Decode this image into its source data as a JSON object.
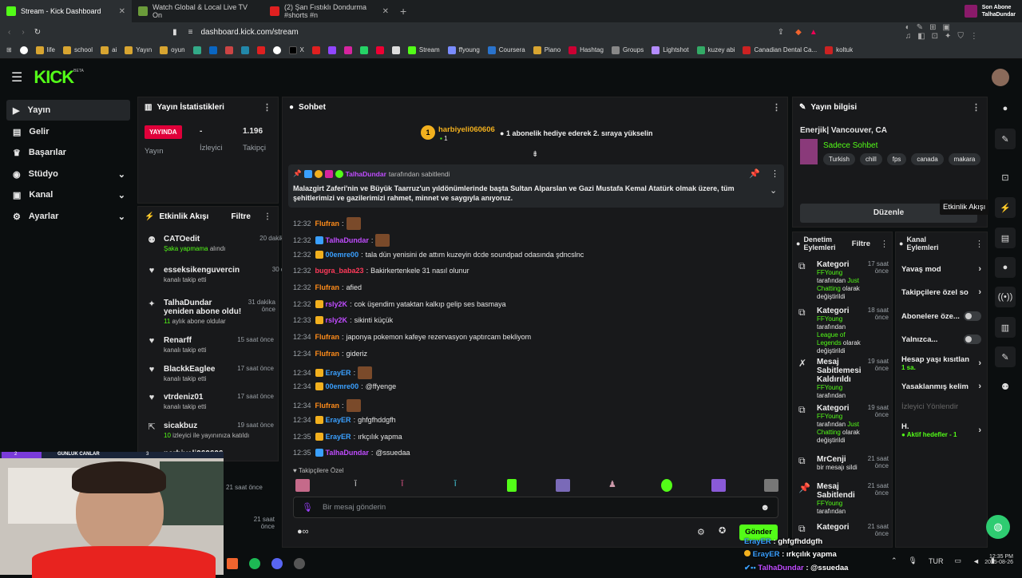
{
  "browser": {
    "tabs": [
      {
        "title": "Stream - Kick Dashboard",
        "color": "#53fc18"
      },
      {
        "title": "Watch Global & Local Live TV On",
        "color": "#6b9b3a"
      },
      {
        "title": "(2) Şan Fıstıklı Dondurma #shorts #n",
        "color": "#e02020"
      }
    ],
    "url": "dashboard.kick.com/stream",
    "bookmarks": [
      "life",
      "school",
      "ai",
      "Yayın",
      "oyun",
      "X",
      "Stream",
      "ffyoung",
      "Coursera",
      "Piano",
      "Hashtag",
      "Groups",
      "Lightshot",
      "kuzey abi",
      "Canadian Dental Ca...",
      "koltuk"
    ],
    "profile": {
      "line1": "Son Abone",
      "line2": "TalhaDundar"
    }
  },
  "kick": {
    "logo": "KICK",
    "beta": "BETA",
    "nav": [
      "Yayın",
      "Gelir",
      "Başarılar",
      "Stüdyo",
      "Kanal",
      "Ayarlar"
    ]
  },
  "stats": {
    "title": "Yayın İstatistikleri",
    "live_badge": "YAYINDA",
    "live_label": "Yayın",
    "viewers_value": "-",
    "viewers_label": "İzleyici",
    "followers_value": "1.196",
    "followers_label": "Takipçi"
  },
  "activity": {
    "title": "Etkinlik Akışı",
    "filter": "Filtre",
    "items": [
      {
        "name": "CATOedit",
        "time": "20 dakika önce",
        "hl": "Şaka yapmama",
        "rest": " alındı"
      },
      {
        "name": "esseksikenguvercin",
        "time": "30 dakika önce",
        "hl": "",
        "rest": "kanalı takip etti"
      },
      {
        "name": "TalhaDundar yeniden abone oldu!",
        "time": "31 dakika önce",
        "hl": "11",
        "rest": " aylık abone oldular"
      },
      {
        "name": "Renarff",
        "time": "15 saat önce",
        "hl": "",
        "rest": "kanalı takip etti"
      },
      {
        "name": "BlackkEaglee",
        "time": "17 saat önce",
        "hl": "",
        "rest": "kanalı takip etti"
      },
      {
        "name": "vtrdeniz01",
        "time": "17 saat önce",
        "hl": "",
        "rest": "kanalı takip etti"
      },
      {
        "name": "sicakbuz",
        "time": "19 saat önce",
        "hl": "10",
        "rest": " izleyici ile yayınınıza katıldı"
      },
      {
        "name": "narbiyeli060606",
        "time": "",
        "hl": "",
        "rest": "llanıcıya"
      }
    ],
    "extra_times": [
      "21 saat önce",
      "21 saat önce"
    ]
  },
  "chat": {
    "title": "Sohbet",
    "top_user": "harbiyeli060606",
    "top_count": "1",
    "top_rank": "1",
    "top_msg": "1 abonelik hediye ederek 2. sıraya yükselin",
    "pinned_by": "TalhaDundar",
    "pinned_suffix": " tarafından sabitlendi",
    "pinned_text": "Malazgirt Zaferi'nin ve Büyük Taarruz'un yıldönümlerinde başta Sultan Alparslan ve Gazi Mustafa Kemal Atatürk olmak üzere, tüm şehitlerimizi ve gazilerimizi rahmet, minnet ve saygıyla anıyoruz.",
    "messages": [
      {
        "time": "12:32",
        "user": "Flufran",
        "color": "#ff8c1a",
        "text": "",
        "emote": true
      },
      {
        "time": "12:32",
        "user": "TalhaDundar",
        "color": "#c04cff",
        "text": "",
        "emote": true
      },
      {
        "time": "12:32",
        "user": "00emre00",
        "color": "#3aa0ff",
        "text": "tala dün yenisini de attım kuzeyin dcde soundpad odasında şdncslnc",
        "emote": false
      },
      {
        "time": "12:32",
        "user": "bugra_baba23",
        "color": "#ff3a5a",
        "text": "Bakirkertenkele 31 nasıl olunur",
        "emote": false
      },
      {
        "time": "12:32",
        "user": "Flufran",
        "color": "#ff8c1a",
        "text": "afied",
        "emote": false
      },
      {
        "time": "12:32",
        "user": "rsly2K",
        "color": "#c04cff",
        "text": "cok üşendim yataktan kalkıp gelip ses basmaya",
        "emote": false
      },
      {
        "time": "12:33",
        "user": "rsly2K",
        "color": "#c04cff",
        "text": "sikinti küçük",
        "emote": false
      },
      {
        "time": "12:34",
        "user": "Flufran",
        "color": "#ff8c1a",
        "text": "japonya pokemon kafeye rezervasyon yaptırcam bekliyom",
        "emote": false
      },
      {
        "time": "12:34",
        "user": "Flufran",
        "color": "#ff8c1a",
        "text": "gideriz",
        "emote": false
      },
      {
        "time": "12:34",
        "user": "ErayER",
        "color": "#3aa0ff",
        "text": "",
        "emote": true
      },
      {
        "time": "12:34",
        "user": "00emre00",
        "color": "#3aa0ff",
        "text": "@ffyenge",
        "emote": false
      },
      {
        "time": "12:34",
        "user": "Flufran",
        "color": "#ff8c1a",
        "text": "",
        "emote": true
      },
      {
        "time": "12:34",
        "user": "ErayER",
        "color": "#3aa0ff",
        "text": "ghfgfhddgfh",
        "emote": false
      },
      {
        "time": "12:35",
        "user": "ErayER",
        "color": "#3aa0ff",
        "text": "ırkçılık yapma",
        "emote": false
      },
      {
        "time": "12:35",
        "user": "TalhaDundar",
        "color": "#c04cff",
        "text": "@ssuedaa",
        "emote": false
      }
    ],
    "followers_only": "Takipçilere Özel",
    "placeholder": "Bir mesaj gönderin",
    "send": "Gönder"
  },
  "info": {
    "title": "Yayın bilgisi",
    "stream_title": "Enerjik| Vancouver, CA",
    "category": "Sadece Sohbet",
    "tags": [
      "Turkish",
      "chill",
      "fps",
      "canada",
      "makara"
    ],
    "edit": "Düzenle",
    "tooltip": "Etkinlik Akışı"
  },
  "mod": {
    "title": "Denetim Eylemleri",
    "filter": "Filtre",
    "items": [
      {
        "name": "Kategori",
        "time": "17 saat önce",
        "by": "FFYoung",
        "mid": " tarafından ",
        "hl": "Just Chatting",
        "rest": " olarak değiştirildi"
      },
      {
        "name": "Kategori",
        "time": "18 saat önce",
        "by": "FFYoung",
        "mid": " tarafından ",
        "hl": "League of Legends",
        "rest": " olarak değiştirildi"
      },
      {
        "name": "Mesaj Sabitlemesi Kaldırıldı",
        "time": "19 saat önce",
        "by": "FFYoung",
        "mid": " tarafından",
        "hl": "",
        "rest": ""
      },
      {
        "name": "Kategori",
        "time": "19 saat önce",
        "by": "FFYoung",
        "mid": " tarafından ",
        "hl": "Just Chatting",
        "rest": " olarak değiştirildi"
      },
      {
        "name": "MrCenji",
        "time": "21 saat önce",
        "by": "",
        "mid": "bir mesajı sildi",
        "hl": "",
        "rest": ""
      },
      {
        "name": "Mesaj Sabitlendi",
        "time": "21 saat önce",
        "by": "FFYoung",
        "mid": " tarafından",
        "hl": "",
        "rest": ""
      },
      {
        "name": "Kategori",
        "time": "21 saat önce",
        "by": "",
        "mid": "",
        "hl": "",
        "rest": ""
      }
    ]
  },
  "channel": {
    "title": "Kanal Eylemleri",
    "items": [
      {
        "label": "Yavaş mod",
        "kind": "arrow",
        "sub": ""
      },
      {
        "label": "Takipçilere özel so",
        "kind": "arrow",
        "sub": ""
      },
      {
        "label": "Abonelere öze...",
        "kind": "toggle",
        "sub": ""
      },
      {
        "label": "Yalnızca...",
        "kind": "toggle",
        "sub": ""
      },
      {
        "label": "Hesap yaşı kısıtlan",
        "kind": "arrow",
        "sub": "1 sa."
      },
      {
        "label": "Yasaklanmış kelim",
        "kind": "arrow",
        "sub": ""
      },
      {
        "label": "İzleyici Yönlendir",
        "kind": "dim",
        "sub": ""
      },
      {
        "label": "H.",
        "kind": "arrow",
        "sub": "● Aktif hedefler - 1"
      }
    ]
  },
  "overlay": {
    "label": "GUNLUK CANLAR",
    "count_left": "2",
    "count_right": "3",
    "chat": [
      {
        "user": "ErayER",
        "text": "ghfgfhddgfh"
      },
      {
        "user": "ErayER",
        "text": "ırkçılık yapma"
      },
      {
        "user": "TalhaDundar",
        "text": "@ssuedaa"
      }
    ]
  },
  "taskbar": {
    "lang": "TUR",
    "time": "12:35 PM",
    "date": "2025-08-26"
  }
}
